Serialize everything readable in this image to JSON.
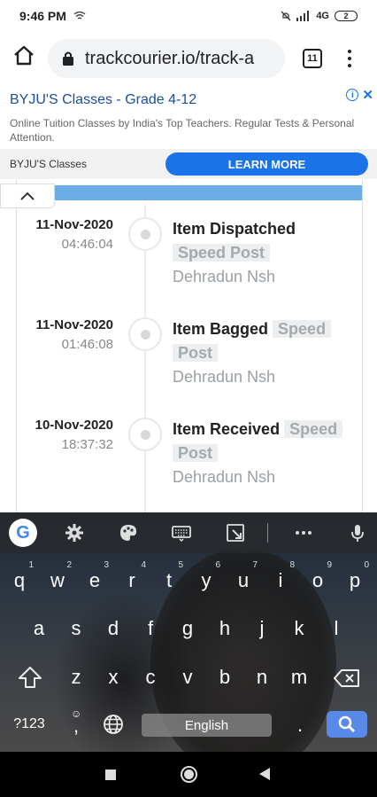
{
  "status_bar": {
    "time": "9:46 PM",
    "network": "4G",
    "battery": "2"
  },
  "browser": {
    "url": "trackcourier.io/track-a",
    "tab_count": "11"
  },
  "ad": {
    "title": "BYJU'S Classes - Grade 4-12",
    "description": "Online Tuition Classes by India's Top Teachers. Regular Tests & Personal Attention.",
    "brand": "BYJU'S Classes",
    "cta": "LEARN MORE"
  },
  "events": [
    {
      "date": "11-Nov-2020",
      "time": "04:46:04",
      "title": "Item Dispatched",
      "badge": "Speed Post",
      "place": "Dehradun Nsh"
    },
    {
      "date": "11-Nov-2020",
      "time": "01:46:08",
      "title": "Item Bagged",
      "badge": "Speed Post",
      "place": "Dehradun Nsh"
    },
    {
      "date": "10-Nov-2020",
      "time": "18:37:32",
      "title": "Item Received",
      "badge": "Speed Post",
      "place": "Dehradun Nsh"
    }
  ],
  "keyboard": {
    "row1": [
      "q",
      "w",
      "e",
      "r",
      "t",
      "y",
      "u",
      "i",
      "o",
      "p"
    ],
    "row1_hints": [
      "1",
      "2",
      "3",
      "4",
      "5",
      "6",
      "7",
      "8",
      "9",
      "0"
    ],
    "row2": [
      "a",
      "s",
      "d",
      "f",
      "g",
      "h",
      "j",
      "k",
      "l"
    ],
    "row3": [
      "z",
      "x",
      "c",
      "v",
      "b",
      "n",
      "m"
    ],
    "symbols_key": "?123",
    "comma_key": ",",
    "space_label": "English",
    "period_key": "."
  },
  "icons": {
    "home": "home-icon",
    "lock": "lock-icon",
    "menu": "more-vert-icon",
    "google": "google-icon",
    "settings": "gear-icon",
    "theme": "palette-icon",
    "keyboard": "keyboard-icon",
    "resize": "resize-icon",
    "more": "more-horiz-icon",
    "mic": "mic-icon",
    "shift": "shift-icon",
    "backspace": "backspace-icon",
    "emoji": "emoji-icon",
    "globe": "globe-icon",
    "search": "search-icon"
  },
  "colors": {
    "accent": "#1a73e8",
    "header_bar": "#6aace6",
    "badge_bg": "#eceeef"
  }
}
